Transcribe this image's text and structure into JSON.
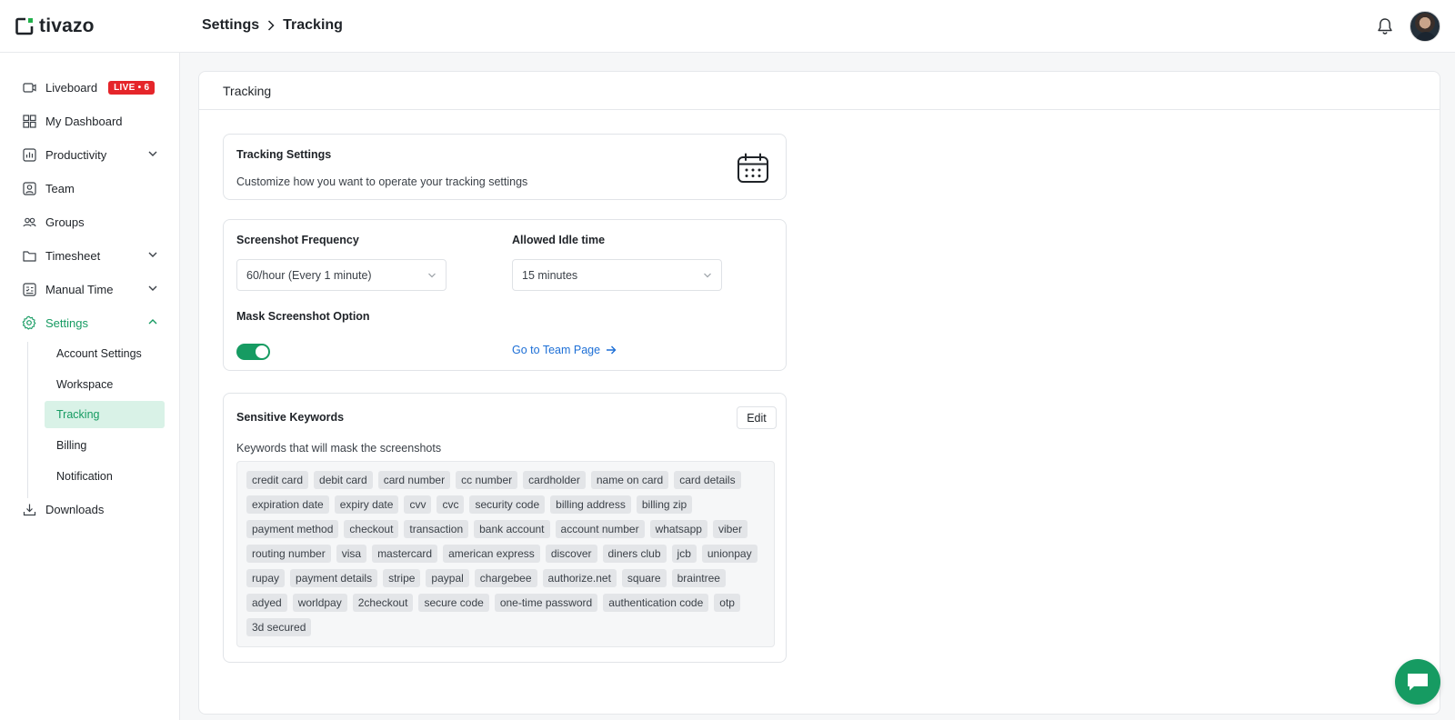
{
  "brand": {
    "name": "tivazo",
    "accent": "#169b62"
  },
  "header": {
    "breadcrumb": [
      "Settings",
      "Tracking"
    ],
    "icons": {
      "separator": "chevron-right-icon",
      "notifications": "bell-icon",
      "profile": "avatar"
    }
  },
  "sidebar": {
    "items": [
      {
        "label": "Liveboard",
        "icon": "liveboard-icon",
        "badge": "LIVE • 6"
      },
      {
        "label": "My Dashboard",
        "icon": "dashboard-grid-icon"
      },
      {
        "label": "Productivity",
        "icon": "productivity-chart-icon",
        "expandable": true
      },
      {
        "label": "Team",
        "icon": "team-user-icon"
      },
      {
        "label": "Groups",
        "icon": "groups-icon"
      },
      {
        "label": "Timesheet",
        "icon": "folder-icon",
        "expandable": true
      },
      {
        "label": "Manual Time",
        "icon": "manual-time-icon",
        "expandable": true
      },
      {
        "label": "Settings",
        "icon": "gear-icon",
        "expanded": true,
        "active": true
      },
      {
        "label": "Downloads",
        "icon": "download-icon"
      }
    ],
    "settings_sub": [
      "Account Settings",
      "Workspace",
      "Tracking",
      "Billing",
      "Notification"
    ],
    "active_sub": "Tracking"
  },
  "panel": {
    "title": "Tracking",
    "tracking_settings": {
      "title": "Tracking Settings",
      "description": "Customize how you want to operate your tracking settings",
      "icon": "calendar-icon"
    },
    "options": {
      "screenshot_frequency_label": "Screenshot Frequency",
      "screenshot_frequency_value": "60/hour (Every 1 minute)",
      "idle_time_label": "Allowed Idle time",
      "idle_time_value": "15 minutes",
      "mask_label": "Mask Screenshot Option",
      "mask_enabled": true,
      "team_link": "Go to Team Page"
    },
    "keywords": {
      "title": "Sensitive Keywords",
      "edit_label": "Edit",
      "description": "Keywords that will mask the screenshots",
      "items": [
        "credit card",
        "debit card",
        "card number",
        "cc number",
        "cardholder",
        "name on card",
        "card details",
        "expiration date",
        "expiry date",
        "cvv",
        "cvc",
        "security code",
        "billing address",
        "billing zip",
        "payment method",
        "checkout",
        "transaction",
        "bank account",
        "account number",
        "whatsapp",
        "viber",
        "routing number",
        "visa",
        "mastercard",
        "american express",
        "discover",
        "diners club",
        "jcb",
        "unionpay",
        "rupay",
        "payment details",
        "stripe",
        "paypal",
        "chargebee",
        "authorize.net",
        "square",
        "braintree",
        "adyed",
        "worldpay",
        "2checkout",
        "secure code",
        "one-time password",
        "authentication code",
        "otp",
        "3d secured"
      ]
    }
  },
  "chat": {
    "icon": "chat-bubble-icon"
  }
}
